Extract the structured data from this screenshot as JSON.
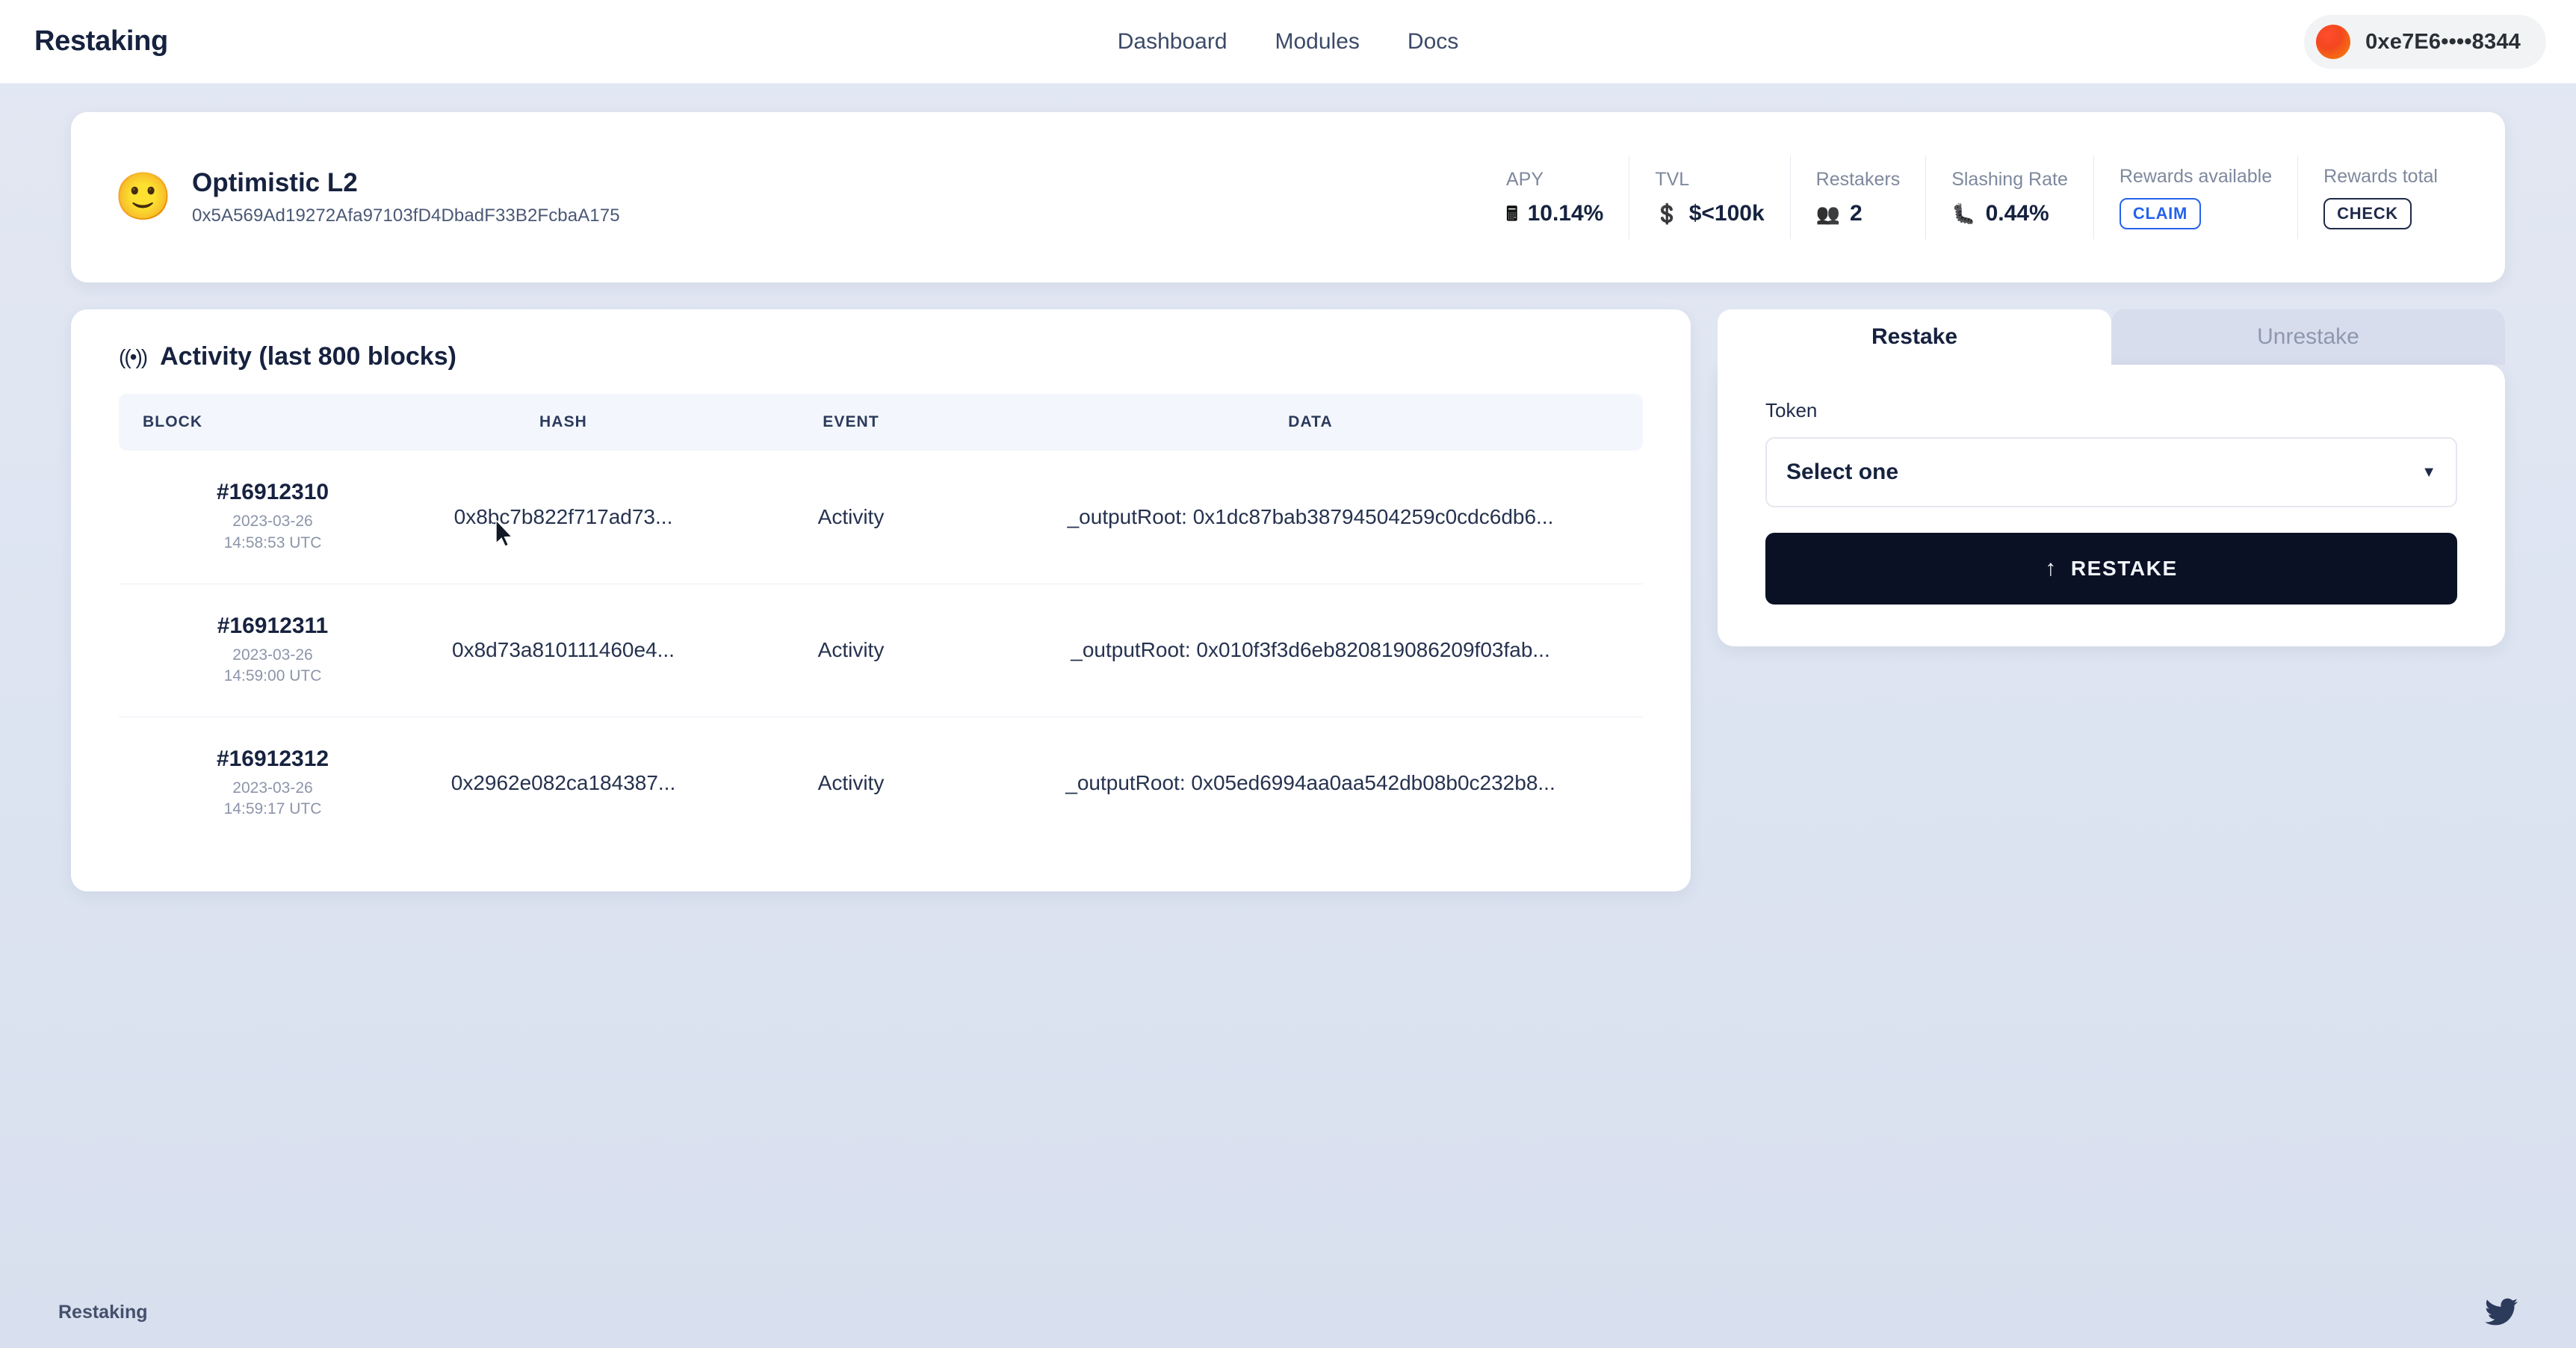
{
  "header": {
    "brand": "Restaking",
    "nav": [
      {
        "label": "Dashboard",
        "name": "nav-link-dashboard"
      },
      {
        "label": "Modules",
        "name": "nav-link-modules"
      },
      {
        "label": "Docs",
        "name": "nav-link-docs"
      }
    ],
    "wallet": {
      "address": "0xe7E6••••8344",
      "avatar_color": "#f4471f"
    }
  },
  "module": {
    "emoji": "🙂",
    "name": "Optimistic L2",
    "address": "0x5A569Ad19272Afa97103fD4DbadF33B2FcbaA175",
    "stats": [
      {
        "label": "APY",
        "icon": "🖩",
        "icon_name": "calculator-icon",
        "value": "10.14%"
      },
      {
        "label": "TVL",
        "icon": "💲",
        "icon_name": "dollar-coin-icon",
        "value": "$<100k"
      },
      {
        "label": "Restakers",
        "icon": "👥",
        "icon_name": "people-icon",
        "value": "2"
      },
      {
        "label": "Slashing Rate",
        "icon": "🐛",
        "icon_name": "bug-icon",
        "value": "0.44%"
      }
    ],
    "rewards_available": {
      "label": "Rewards available",
      "button": "CLAIM",
      "color": "#2563eb"
    },
    "rewards_total": {
      "label": "Rewards total",
      "button": "CHECK",
      "color": "#1f2a49"
    }
  },
  "activity": {
    "icon": "((•))",
    "title": "Activity (last 800 blocks)",
    "columns": [
      "BLOCK",
      "HASH",
      "EVENT",
      "DATA"
    ],
    "rows": [
      {
        "block": "#16912310",
        "date": "2023-03-26",
        "time": "14:58:53 UTC",
        "hash": "0x8bc7b822f717ad73...",
        "event": "Activity",
        "data": "_outputRoot: 0x1dc87bab38794504259c0cdc6db6..."
      },
      {
        "block": "#16912311",
        "date": "2023-03-26",
        "time": "14:59:00 UTC",
        "hash": "0x8d73a810111460e4...",
        "event": "Activity",
        "data": "_outputRoot: 0x010f3f3d6eb820819086209f03fab..."
      },
      {
        "block": "#16912312",
        "date": "2023-03-26",
        "time": "14:59:17 UTC",
        "hash": "0x2962e082ca184387...",
        "event": "Activity",
        "data": "_outputRoot: 0x05ed6994aa0aa542db08b0c232b8..."
      }
    ]
  },
  "stake": {
    "tabs": [
      {
        "label": "Restake",
        "active": true
      },
      {
        "label": "Unrestake",
        "active": false
      }
    ],
    "token_label": "Token",
    "token_value": "Select one",
    "caret": "▼",
    "submit_label": "RESTAKE",
    "submit_icon": "↑"
  },
  "footer": {
    "brand": "Restaking",
    "social_icon": "twitter-icon"
  }
}
